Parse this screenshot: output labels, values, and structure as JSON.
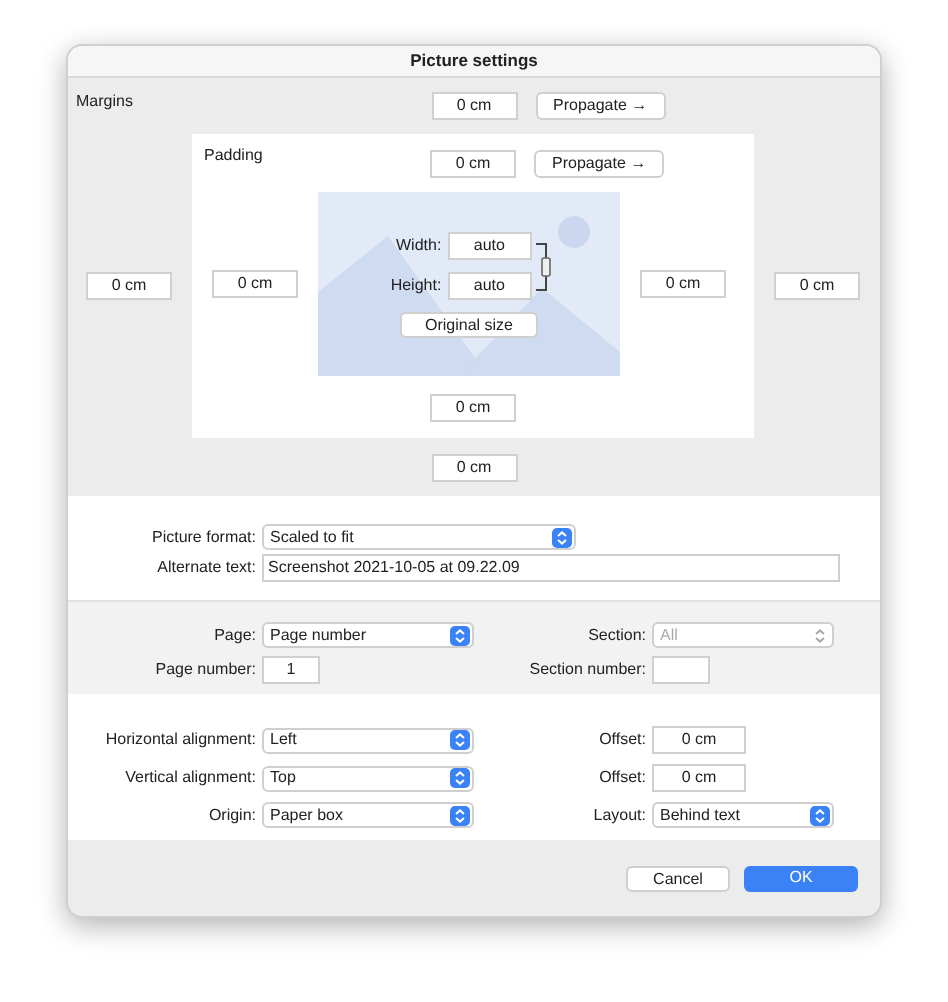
{
  "window": {
    "title": "Picture settings"
  },
  "margins": {
    "label": "Margins",
    "top": "0 cm",
    "left": "0 cm",
    "right": "0 cm",
    "bottom": "0 cm",
    "propagate": "Propagate →"
  },
  "padding": {
    "label": "Padding",
    "top": "0 cm",
    "left": "0 cm",
    "right": "0 cm",
    "bottom": "0 cm",
    "propagate": "Propagate →"
  },
  "size": {
    "width_label": "Width:",
    "width": "auto",
    "height_label": "Height:",
    "height": "auto",
    "original_size": "Original size"
  },
  "format": {
    "picture_format": {
      "label": "Picture format:",
      "value": "Scaled to fit"
    },
    "alternate_text": {
      "label": "Alternate text:",
      "value": "Screenshot 2021-10-05 at 09.22.09"
    }
  },
  "page": {
    "page": {
      "label": "Page:",
      "value": "Page number"
    },
    "section": {
      "label": "Section:",
      "value": "All",
      "disabled": true
    },
    "page_number": {
      "label": "Page number:",
      "value": "1"
    },
    "section_number": {
      "label": "Section number:"
    }
  },
  "alignment": [
    {
      "label": "Horizontal alignment:",
      "value": "Left",
      "right": {
        "kind": "field",
        "label": "Offset:",
        "value": "0 cm"
      }
    },
    {
      "label": "Vertical alignment:",
      "value": "Top",
      "right": {
        "kind": "field",
        "label": "Offset:",
        "value": "0 cm"
      }
    },
    {
      "label": "Origin:",
      "value": "Paper box",
      "right": {
        "kind": "dropdown",
        "label": "Layout:",
        "value": "Behind text"
      }
    }
  ],
  "buttons": [
    {
      "label": "Cancel",
      "default": false
    },
    {
      "label": "OK",
      "default": true
    }
  ]
}
